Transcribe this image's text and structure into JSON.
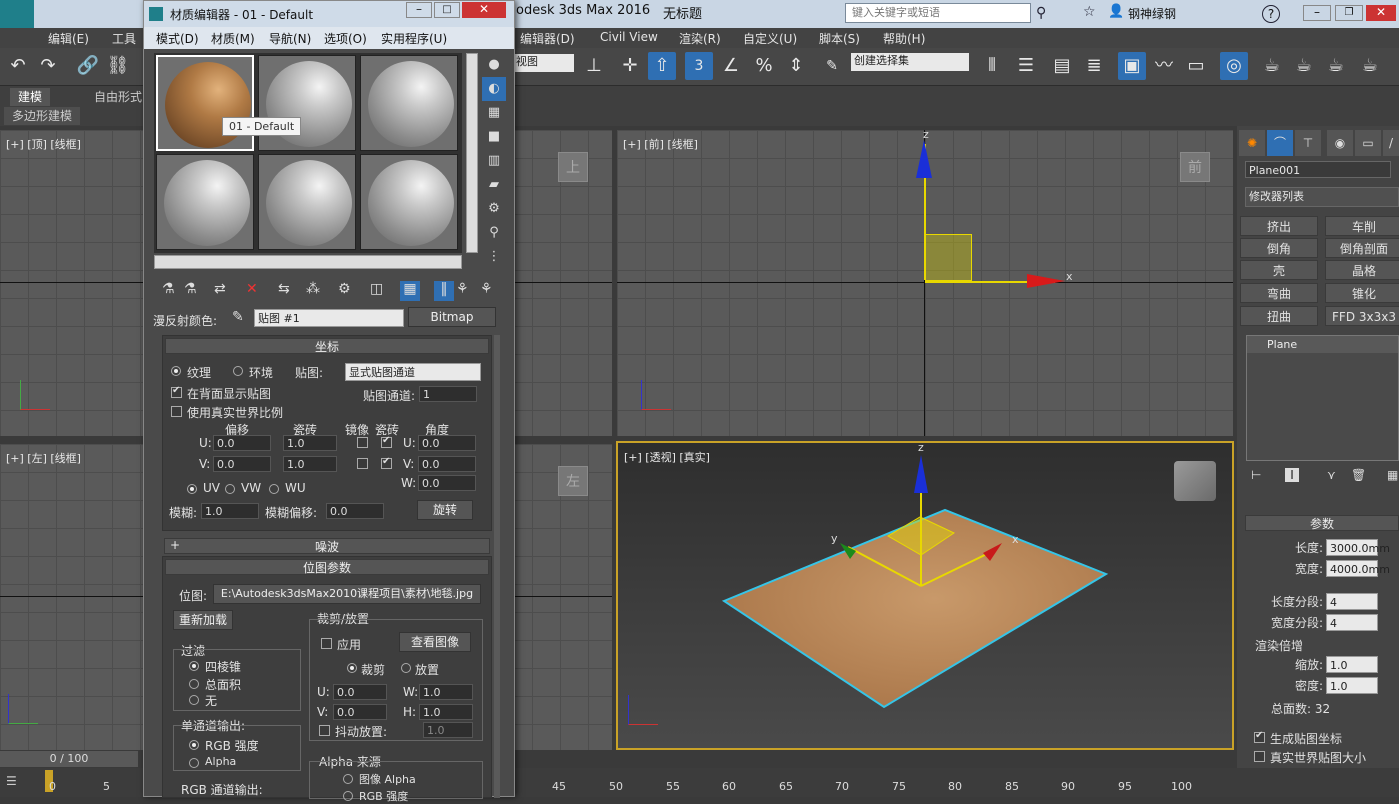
{
  "app": {
    "title_left": "odesk 3ds Max 2016",
    "doc_title": "无标题",
    "search_placeholder": "键入关键字或短语",
    "user": "钢神绿钢",
    "logo": "MAX"
  },
  "main_menu": [
    "编辑(E)",
    "工具",
    "编辑器(D)",
    "Civil View",
    "渲染(R)",
    "自定义(U)",
    "脚本(S)",
    "帮助(H)"
  ],
  "toolbar": {
    "selection_set": "创建选择集",
    "ref_coord": "视图",
    "snap_num": "3"
  },
  "ribbon": {
    "tabs": [
      "建模",
      "自由形式"
    ],
    "sub": "多边形建模"
  },
  "viewports": {
    "top": "[+] [顶] [线框]",
    "front": "[+] [前] [线框]",
    "left": "[+] [左] [线框]",
    "persp": "[+] [透视] [真实]",
    "cube_top": "上",
    "cube_front": "前",
    "cube_left": "左",
    "axis_x": "x",
    "axis_y": "y",
    "axis_z": "z"
  },
  "command_panel": {
    "object_name": "Plane001",
    "modifier_list": "修改器列表",
    "buttons": [
      "挤出",
      "车削",
      "倒角",
      "倒角剖面",
      "壳",
      "晶格",
      "弯曲",
      "锥化",
      "扭曲",
      "FFD 3x3x3"
    ],
    "stack_item": "Plane",
    "params_header": "参数",
    "length_label": "长度:",
    "length_value": "3000.0mm",
    "width_label": "宽度:",
    "width_value": "4000.0mm",
    "lsegs_label": "长度分段:",
    "lsegs_value": "4",
    "wsegs_label": "宽度分段:",
    "wsegs_value": "4",
    "render_mult": "渲染倍增",
    "scale_label": "缩放:",
    "scale_value": "1.0",
    "density_label": "密度:",
    "density_value": "1.0",
    "faces_label": "总面数: 32",
    "gen_map": "生成贴图坐标",
    "real_world": "真实世界贴图大小"
  },
  "timeline": {
    "frame": "0 / 100",
    "ticks": [
      "0",
      "5",
      "45",
      "50",
      "55",
      "60",
      "65",
      "70",
      "75",
      "80",
      "85",
      "90",
      "95",
      "100"
    ]
  },
  "mat_editor": {
    "title": "材质编辑器 - 01 - Default",
    "menu": [
      "模式(D)",
      "材质(M)",
      "导航(N)",
      "选项(O)",
      "实用程序(U)"
    ],
    "tooltip": "01 - Default",
    "diffuse_label": "漫反射颜色:",
    "map_name": "贴图 #1",
    "map_type": "Bitmap",
    "coords_header": "坐标",
    "texture": "纹理",
    "environ": "环境",
    "mapping_label": "贴图:",
    "mapping_value": "显式贴图通道",
    "show_back": "在背面显示贴图",
    "channel_label": "贴图通道:",
    "channel_value": "1",
    "use_real": "使用真实世界比例",
    "offset": "偏移",
    "tiling": "瓷砖",
    "mirror": "镜像",
    "tile": "瓷砖",
    "angle": "角度",
    "u": "U:",
    "v": "V:",
    "w": "W:",
    "u_off": "0.0",
    "v_off": "0.0",
    "u_tile": "1.0",
    "v_tile": "1.0",
    "u_ang": "0.0",
    "v_ang": "0.0",
    "w_ang": "0.0",
    "uv": "UV",
    "vw": "VW",
    "wu": "WU",
    "blur_label": "模糊:",
    "blur_value": "1.0",
    "blur_off_label": "模糊偏移:",
    "blur_off_value": "0.0",
    "rotate": "旋转",
    "noise_header": "噪波",
    "bitmap_header": "位图参数",
    "bitmap_label": "位图:",
    "bitmap_path": "E:\\Autodesk3dsMax2010课程项目\\素材\\地毯.jpg",
    "reload": "重新加载",
    "crop_group": "裁剪/放置",
    "apply": "应用",
    "view_image": "查看图像",
    "crop": "裁剪",
    "place": "放置",
    "filter_group": "过滤",
    "pyramidal": "四棱锥",
    "sat": "总面积",
    "none": "无",
    "cu": "U:",
    "cv": "V:",
    "cw": "W:",
    "ch": "H:",
    "cu_val": "0.0",
    "cv_val": "0.0",
    "cw_val": "1.0",
    "ch_val": "1.0",
    "jitter": "抖动放置:",
    "jitter_val": "1.0",
    "mono_group": "单通道输出:",
    "rgb_int": "RGB 强度",
    "alpha": "Alpha",
    "alpha_src": "Alpha 来源",
    "img_alpha": "图像 Alpha",
    "rgb_int2": "RGB 强度",
    "rgb_out": "RGB 通道输出:"
  }
}
